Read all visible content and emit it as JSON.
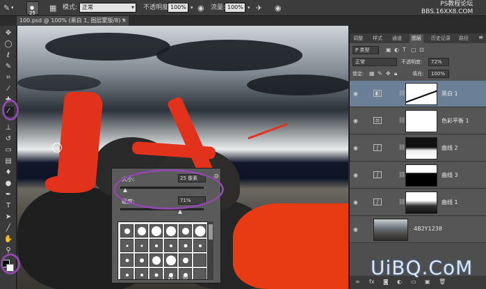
{
  "options_bar": {
    "brush_size": "25",
    "mode_label": "模式:",
    "mode_value": "正常",
    "opacity_label": "不透明度:",
    "opacity_value": "100%",
    "flow_label": "流量:",
    "flow_value": "100%"
  },
  "document_tab": {
    "title": "100.psd @ 100% (黑白 1, 图层蒙版/8) *",
    "close": "×"
  },
  "watermark_top": {
    "line1": "PS教程论坛",
    "line2": "BBS.16XX8.COM"
  },
  "watermark_bottom": "UiBQ.CoM",
  "brush_popup": {
    "size_label": "大小:",
    "size_value": "25 像素",
    "hardness_label": "硬度:",
    "hardness_value": "71%",
    "presets": [
      {
        "diam": 8,
        "num": ""
      },
      {
        "diam": 12,
        "num": ""
      },
      {
        "diam": 14,
        "num": ""
      },
      {
        "diam": 14,
        "num": ""
      },
      {
        "diam": 10,
        "num": ""
      },
      {
        "diam": 15,
        "num": ""
      },
      {
        "diam": 3,
        "num": ""
      },
      {
        "diam": 3,
        "num": ""
      },
      {
        "diam": 4,
        "num": ""
      },
      {
        "diam": 4,
        "num": ""
      },
      {
        "diam": 5,
        "num": ""
      },
      {
        "diam": 4,
        "num": ""
      },
      {
        "diam": 5,
        "num": ""
      },
      {
        "diam": 6,
        "num": ""
      },
      {
        "diam": 12,
        "num": ""
      },
      {
        "diam": 14,
        "num": ""
      },
      {
        "diam": 8,
        "num": ""
      },
      {
        "diam": 0,
        "num": ""
      },
      {
        "diam": 4,
        "num": ""
      },
      {
        "diam": 4,
        "num": ""
      },
      {
        "diam": 5,
        "num": ""
      },
      {
        "diam": 6,
        "num": "25"
      },
      {
        "diam": 6,
        "num": "50"
      },
      {
        "diam": 0,
        "num": ""
      }
    ]
  },
  "panel": {
    "tabs": [
      "调整",
      "样式",
      "通道",
      "图层",
      "历史记录",
      "路径"
    ],
    "active_tab": 3,
    "menu": "≡",
    "filter_label": "P 类型",
    "blend_value": "正常",
    "opacity_label": "不透明度:",
    "opacity_value": "72%",
    "lock_label": "锁定:",
    "fill_label": "填充:",
    "fill_value": "100%",
    "layers": [
      {
        "name": "黑白 1",
        "selected": true,
        "type": "adjust"
      },
      {
        "name": "色彩平衡 1",
        "selected": false,
        "type": "balance"
      },
      {
        "name": "曲线 2",
        "selected": false,
        "type": "curves"
      },
      {
        "name": "曲线 3",
        "selected": false,
        "type": "curves"
      },
      {
        "name": "曲线 1",
        "selected": false,
        "type": "curves"
      },
      {
        "name": "4B2Y1238",
        "selected": false,
        "type": "image"
      }
    ]
  }
}
